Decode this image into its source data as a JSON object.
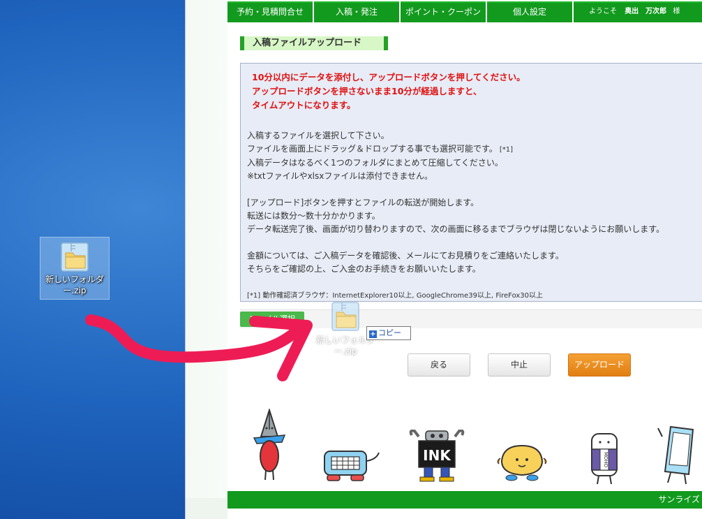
{
  "nav": {
    "items": [
      "予約・見積問合せ",
      "入稿・発注",
      "ポイント・クーポン",
      "個人設定"
    ],
    "welcome_prefix": "ようこそ",
    "welcome_name": "奥出　万次郎",
    "welcome_suffix": "様"
  },
  "section_title": "入稿ファイルアップロード",
  "panel": {
    "warning_lines": [
      "10分以内にデータを添付し、アップロードボタンを押してください。",
      "アップロードボタンを押さないまま10分が経過しますと、",
      "タイムアウトになります。"
    ],
    "para1": [
      "入稿するファイルを選択して下さい。",
      "ファイルを画面上にドラッグ＆ドロップする事でも選択可能です。",
      "入稿データはなるべく1つのフォルダにまとめて圧縮してください。",
      "※txtファイルやxlsxファイルは添付できません。"
    ],
    "para1_footnote_mark": "[*1]",
    "para2": [
      "[アップロード]ボタンを押すとファイルの転送が開始します。",
      "転送には数分～数十分かかります。",
      "データ転送完了後、画面が切り替わりますので、次の画面に移るまでブラウザは閉じないようにお願いします。"
    ],
    "para3": [
      "金額については、ご入稿データを確認後、メールにてお見積りをご連絡いたします。",
      "そちらをご確認の上、ご入金のお手続きをお願いいたします。"
    ],
    "note": "[*1] 動作確認済ブラウザ：InternetExplorer10以上, GoogleChrome39以上, FireFox30以上"
  },
  "file_button": "ファイル選択",
  "buttons": {
    "back": "戻る",
    "stop": "中止",
    "upload": "アップロード"
  },
  "footer_text": "サンライズ",
  "desktop_icon": {
    "label_line1": "新しいフォルダ",
    "label_line2": "ー.zip"
  },
  "drag_ghost": {
    "label_line1": "新しいフォルダ",
    "label_line2": "ー.zip"
  },
  "copy_tooltip": "コピー",
  "mascot_text": {
    "ink": "INK",
    "moho": "MOHO"
  },
  "colors": {
    "nav_green": "#129a1e",
    "warning_red": "#e01010",
    "upload_orange": "#e88a1a",
    "arrow_pink": "#ee1c55"
  }
}
